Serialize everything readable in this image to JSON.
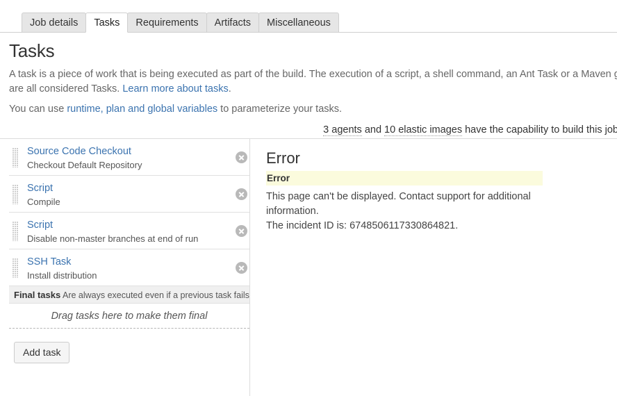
{
  "tabs": [
    {
      "label": "Job details",
      "active": false
    },
    {
      "label": "Tasks",
      "active": true
    },
    {
      "label": "Requirements",
      "active": false
    },
    {
      "label": "Artifacts",
      "active": false
    },
    {
      "label": "Miscellaneous",
      "active": false
    }
  ],
  "page": {
    "title": "Tasks",
    "intro_1_before": "A task is a piece of work that is being executed as part of the build. The execution of a script, a shell command, an Ant Task or a Maven goal are all considered Tasks. ",
    "intro_1_link": "Learn more about tasks",
    "intro_1_after": ".",
    "intro_2_before": "You can use ",
    "intro_2_link": "runtime, plan and global variables",
    "intro_2_after": " to parameterize your tasks.",
    "agent_note_1": "3 agents",
    "agent_note_mid": " and ",
    "agent_note_2": "10 elastic images",
    "agent_note_after": " have the capability to build this job."
  },
  "tasklist": {
    "tasks": [
      {
        "title": "Source Code Checkout",
        "subtitle": "Checkout Default Repository",
        "delete_label": "×"
      },
      {
        "title": "Script",
        "subtitle": "Compile",
        "delete_label": "×"
      },
      {
        "title": "Script",
        "subtitle": "Disable non-master branches at end of run",
        "delete_label": "×"
      },
      {
        "title": "SSH Task",
        "subtitle": "Install distribution",
        "delete_label": "×"
      }
    ],
    "final_header_bold": "Final tasks",
    "final_header_text": " Are always executed even if a previous task fails",
    "dropzone_text": "Drag tasks here to make them final",
    "add_task_label": "Add task"
  },
  "error_panel": {
    "heading": "Error",
    "band_label": "Error",
    "message": "This page can't be displayed. Contact support for additional information.",
    "incident_line": "The incident ID is: 6748506117330864821."
  },
  "colors": {
    "link": "#3b73af",
    "tab_inactive_bg": "#e6e6e6",
    "tab_active_bg": "#ffffff",
    "error_band_bg": "#fbfbdd",
    "border": "#dcdcdc",
    "grip": "#b9b9b9"
  }
}
